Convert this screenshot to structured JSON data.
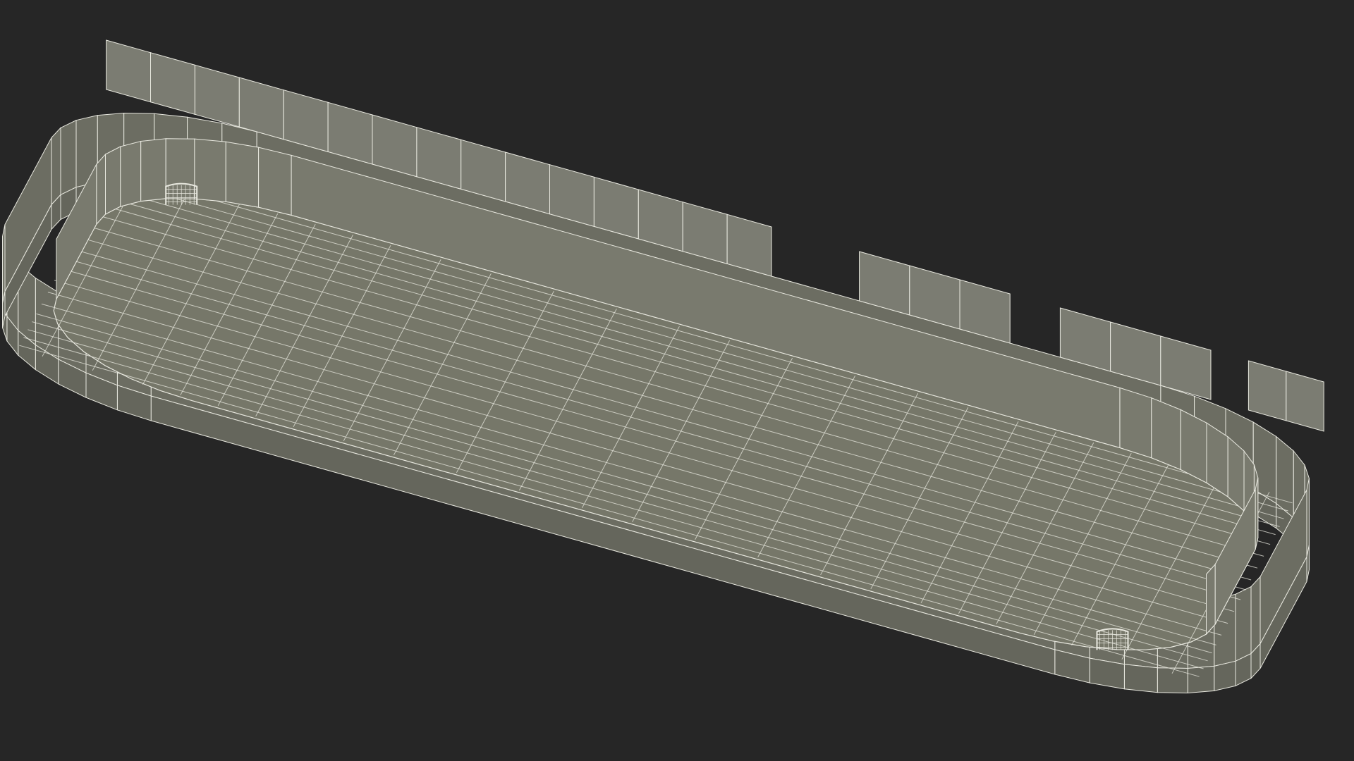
{
  "scene": {
    "subject": "hockey-rink-wireframe-model",
    "render_style": "wireframe",
    "colors": {
      "background": "#262626",
      "rink_floor": "#767769",
      "board_inner_wall": "#797a6e",
      "board_outer_wall": "#6c6d62",
      "board_base": "#65665c",
      "glass": "#8b8c80",
      "wire": "#e8e8df"
    },
    "icons": [
      "goal-net-icon"
    ]
  }
}
